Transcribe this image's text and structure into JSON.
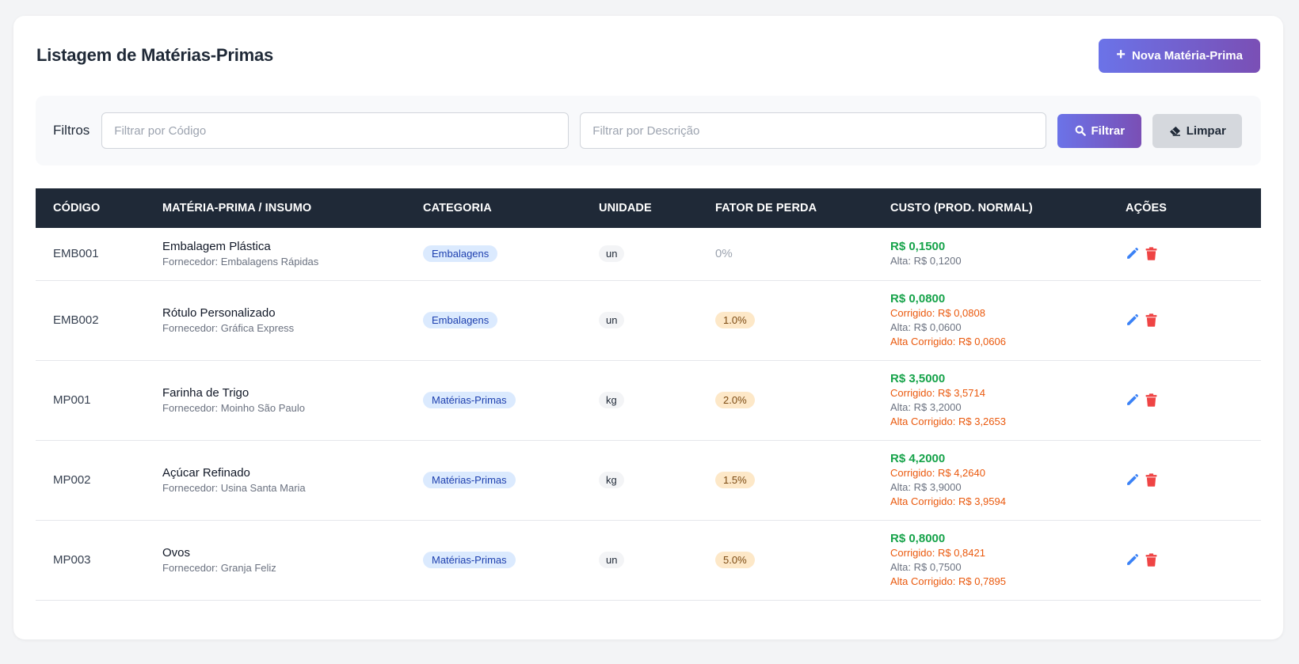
{
  "header": {
    "title": "Listagem de Matérias-Primas",
    "new_button": "Nova Matéria-Prima"
  },
  "filters": {
    "label": "Filtros",
    "code_placeholder": "Filtrar por Código",
    "desc_placeholder": "Filtrar por Descrição",
    "filter_button": "Filtrar",
    "clear_button": "Limpar"
  },
  "table": {
    "columns": [
      "Código",
      "Matéria-Prima / Insumo",
      "Categoria",
      "Unidade",
      "Fator de Perda",
      "Custo (Prod. Normal)",
      "Ações"
    ],
    "rows": [
      {
        "code": "EMB001",
        "name": "Embalagem Plástica",
        "supplier": "Fornecedor: Embalagens Rápidas",
        "category": "Embalagens",
        "unit": "un",
        "loss": "0%",
        "cost": "R$ 0,1500",
        "corrected": "",
        "alt": "Alta: R$ 0,1200",
        "alt_corrected": ""
      },
      {
        "code": "EMB002",
        "name": "Rótulo Personalizado",
        "supplier": "Fornecedor: Gráfica Express",
        "category": "Embalagens",
        "unit": "un",
        "loss": "1.0%",
        "cost": "R$ 0,0800",
        "corrected": "Corrigido: R$ 0,0808",
        "alt": "Alta: R$ 0,0600",
        "alt_corrected": "Alta Corrigido: R$ 0,0606"
      },
      {
        "code": "MP001",
        "name": "Farinha de Trigo",
        "supplier": "Fornecedor: Moinho São Paulo",
        "category": "Matérias-Primas",
        "unit": "kg",
        "loss": "2.0%",
        "cost": "R$ 3,5000",
        "corrected": "Corrigido: R$ 3,5714",
        "alt": "Alta: R$ 3,2000",
        "alt_corrected": "Alta Corrigido: R$ 3,2653"
      },
      {
        "code": "MP002",
        "name": "Açúcar Refinado",
        "supplier": "Fornecedor: Usina Santa Maria",
        "category": "Matérias-Primas",
        "unit": "kg",
        "loss": "1.5%",
        "cost": "R$ 4,2000",
        "corrected": "Corrigido: R$ 4,2640",
        "alt": "Alta: R$ 3,9000",
        "alt_corrected": "Alta Corrigido: R$ 3,9594"
      },
      {
        "code": "MP003",
        "name": "Ovos",
        "supplier": "Fornecedor: Granja Feliz",
        "category": "Matérias-Primas",
        "unit": "un",
        "loss": "5.0%",
        "cost": "R$ 0,8000",
        "corrected": "Corrigido: R$ 0,8421",
        "alt": "Alta: R$ 0,7500",
        "alt_corrected": "Alta Corrigido: R$ 0,7895"
      }
    ]
  },
  "icons": {
    "new": "plus-icon",
    "filter": "search-icon",
    "clear": "eraser-icon",
    "edit": "pencil-icon",
    "delete": "trash-icon"
  },
  "colors": {
    "accent_start": "#6b73e8",
    "accent_end": "#7a4fb5",
    "table_header": "#1f2937",
    "cost_green": "#16a34a",
    "corrected_orange": "#ea580c",
    "edit_blue": "#3b82f6",
    "delete_red": "#ef4444"
  }
}
